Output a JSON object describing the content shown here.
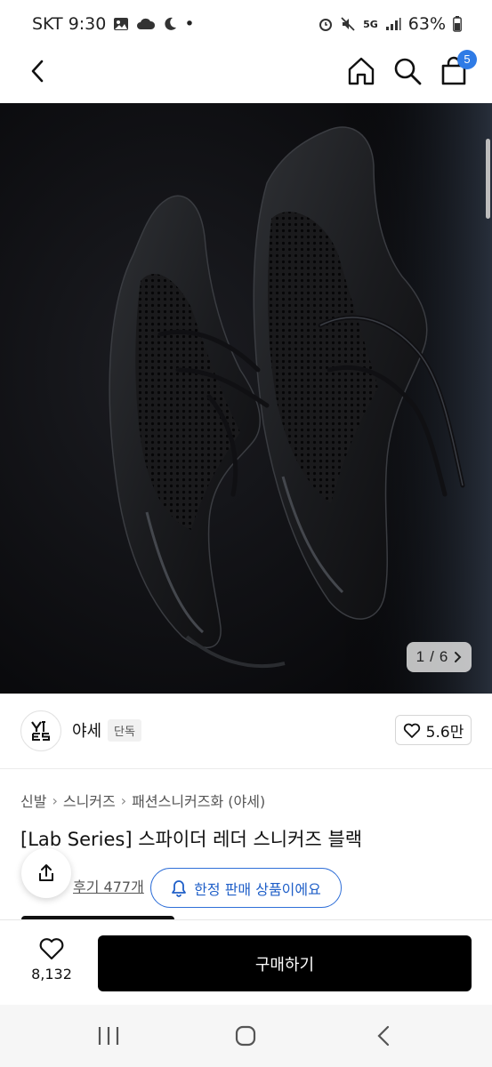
{
  "status_bar": {
    "carrier_time": "SKT 9:30",
    "dot": "•",
    "network": "5G",
    "battery": "63%"
  },
  "nav": {
    "cart_count": "5",
    "accent_color": "#2f7be6"
  },
  "gallery": {
    "current": "1",
    "separator": "/",
    "total": "6"
  },
  "brand": {
    "logo_text": "YASE",
    "name": "야세",
    "tag": "단독",
    "likes": "5.6만"
  },
  "product": {
    "breadcrumb": [
      "신발",
      "스니커즈",
      "패션스니커즈화 (야세)"
    ],
    "title": "[Lab Series] 스파이더 레더 스니커즈 블랙",
    "reviews": "후기 477개",
    "limited_notice": "한정 판매 상품이에요"
  },
  "bottom_bar": {
    "wish_count": "8,132",
    "buy_label": "구매하기"
  }
}
